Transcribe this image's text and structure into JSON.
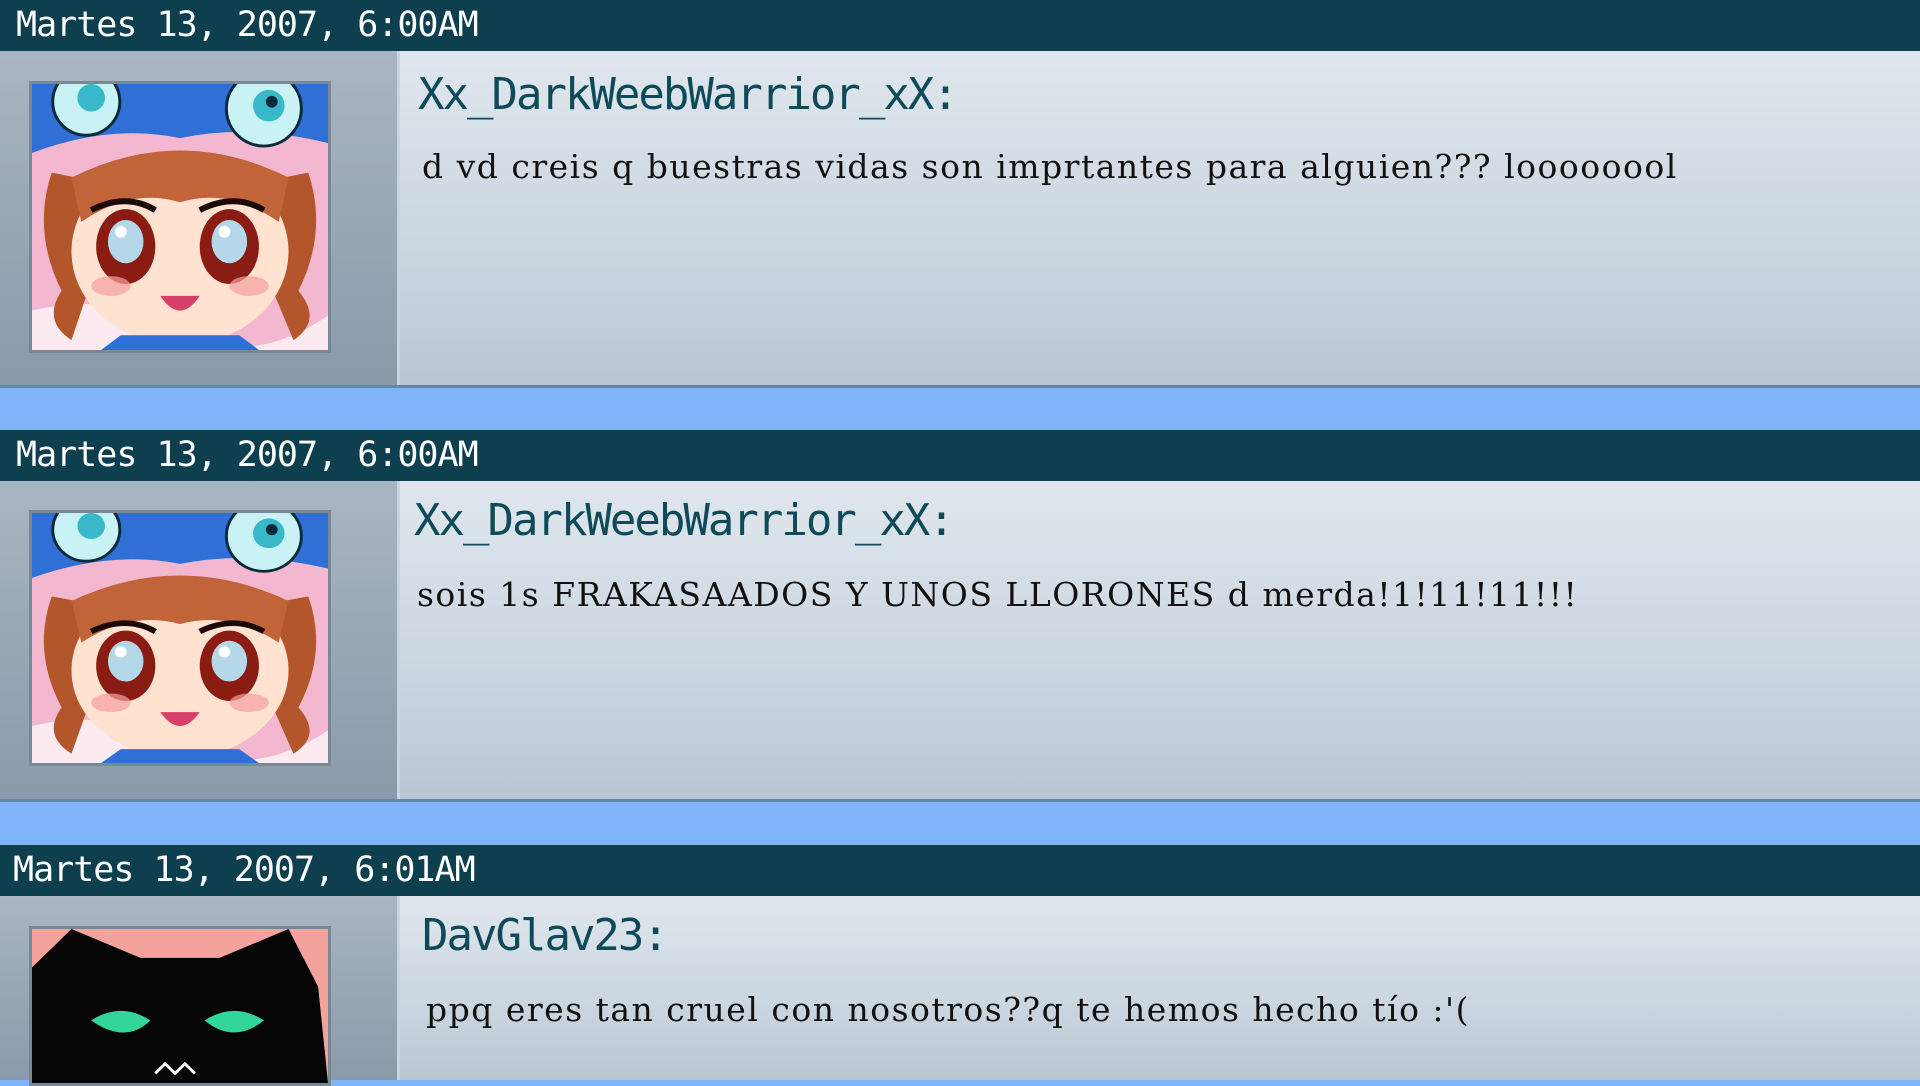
{
  "posts": [
    {
      "date": "Martes 13, 2007, 6:00AM",
      "username": "Xx_DarkWeebWarrior_xX:",
      "message": "d vd creis q buestras vidas son imprtantes para alguien??? loooooool",
      "avatar": "anime-girl-avatar-icon"
    },
    {
      "date": "Martes 13, 2007, 6:00AM",
      "username": "Xx_DarkWeebWarrior_xX:",
      "message": "sois 1s FRAKASAADOS Y UNOS LLORONES d merda!1!11!11!!!",
      "avatar": "anime-girl-avatar-icon"
    },
    {
      "date": "Martes 13, 2007, 6:01AM",
      "username": "DavGlav23:",
      "message": "ppq eres tan cruel con nosotros??q te hemos hecho tío :'(",
      "avatar": "black-cat-avatar-icon"
    }
  ],
  "colors": {
    "date_bar": "#0e3f4f",
    "username": "#0e4a58",
    "separator": "#80b4f8"
  }
}
